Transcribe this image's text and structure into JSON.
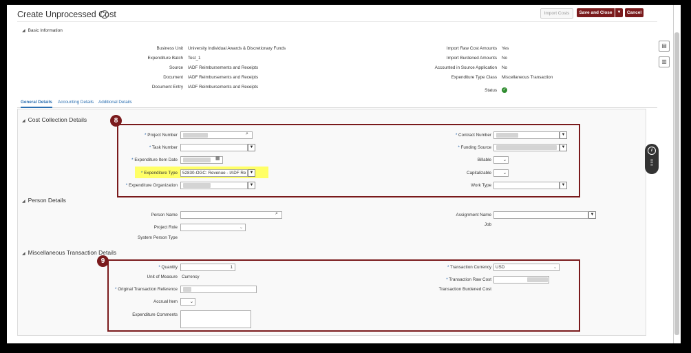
{
  "page": {
    "title": "Create Unprocessed Cost",
    "help_icon": "?",
    "buttons": {
      "import": "Import Costs",
      "save": "Save and Close",
      "save_menu": "▼",
      "cancel": "Cancel"
    }
  },
  "basic_info": {
    "header": "Basic Information",
    "left": [
      {
        "label": "Business Unit",
        "value": "University Individual Awards & Discretionary Funds"
      },
      {
        "label": "Expenditure Batch",
        "value": "Test_1"
      },
      {
        "label": "Source",
        "value": "IADF Reimbursements and Receipts"
      },
      {
        "label": "Document",
        "value": "IADF Reimbursements and Receipts"
      },
      {
        "label": "Document Entry",
        "value": "IADF Reimbursements and Receipts"
      }
    ],
    "right": [
      {
        "label": "Import Raw Cost Amounts",
        "value": "Yes"
      },
      {
        "label": "Import Burdened Amounts",
        "value": "No"
      },
      {
        "label": "Accounted in Source Application",
        "value": "No"
      },
      {
        "label": "Expenditure Type Class",
        "value": "Miscellaneous Transaction"
      },
      {
        "label": "Status",
        "value": ""
      }
    ],
    "status_icon": "check-circle-icon"
  },
  "tabs": [
    {
      "label": "General Details",
      "active": true
    },
    {
      "label": "Accounting Details",
      "active": false
    },
    {
      "label": "Additional Details",
      "active": false
    }
  ],
  "cost_collection": {
    "title": "Cost Collection Details",
    "badge": "8",
    "project_number": "Project Number",
    "task_number": "Task Number",
    "expenditure_item_date": "Expenditure Item Date",
    "expenditure_type": "Expenditure Type",
    "expenditure_type_value": "52830-OGC: Revenue - IADF Re",
    "expenditure_organization": "Expenditure Organization",
    "contract_number": "Contract Number",
    "funding_source": "Funding Source",
    "billable": "Billable",
    "capitalizable": "Capitalizable",
    "work_type": "Work Type"
  },
  "person": {
    "title": "Person Details",
    "person_name": "Person Name",
    "project_role": "Project Role",
    "system_person_type": "System Person Type",
    "assignment_name": "Assignment Name",
    "job": "Job"
  },
  "misc": {
    "title": "Miscellaneous Transaction Details",
    "badge": "9",
    "quantity": "Quantity",
    "quantity_value": "1",
    "unit_of_measure": "Unit of Measure",
    "unit_of_measure_value": "Currency",
    "original_reference": "Original Transaction Reference",
    "accrual_item": "Accrual Item",
    "expenditure_comments": "Expenditure Comments",
    "transaction_currency": "Transaction Currency",
    "transaction_currency_value": "USD",
    "transaction_raw_cost": "Transaction Raw Cost",
    "transaction_burdened_cost": "Transaction Burdened Cost"
  },
  "required_marker": "*",
  "colors": {
    "brand": "#7a1a1c",
    "link": "#2a6eb0",
    "highlight": "#ffff66",
    "required": "#1f5fa8"
  }
}
